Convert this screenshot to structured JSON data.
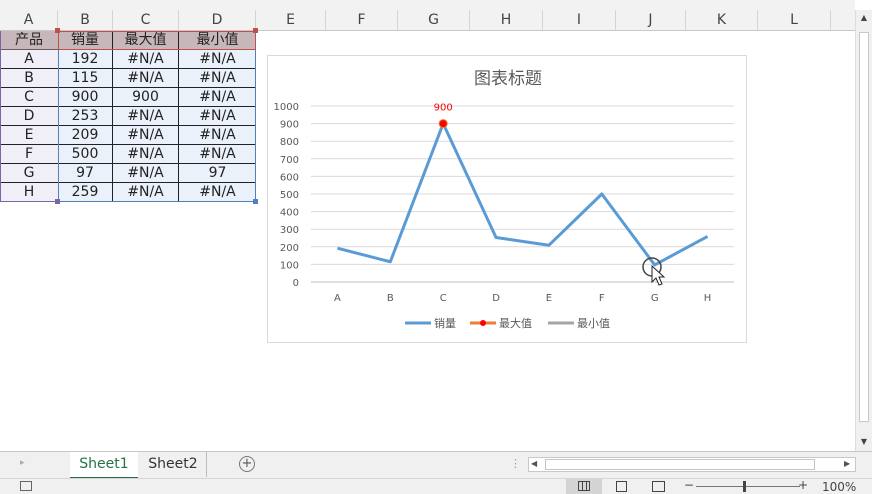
{
  "columns": [
    "A",
    "B",
    "C",
    "D",
    "E",
    "F",
    "G",
    "H",
    "I",
    "J",
    "K",
    "L"
  ],
  "table": {
    "headers": [
      "产品",
      "销量",
      "最大值",
      "最小值"
    ],
    "rows": [
      [
        "A",
        "192",
        "#N/A",
        "#N/A"
      ],
      [
        "B",
        "115",
        "#N/A",
        "#N/A"
      ],
      [
        "C",
        "900",
        "900",
        "#N/A"
      ],
      [
        "D",
        "253",
        "#N/A",
        "#N/A"
      ],
      [
        "E",
        "209",
        "#N/A",
        "#N/A"
      ],
      [
        "F",
        "500",
        "#N/A",
        "#N/A"
      ],
      [
        "G",
        "97",
        "#N/A",
        "97"
      ],
      [
        "H",
        "259",
        "#N/A",
        "#N/A"
      ]
    ]
  },
  "chart_data": {
    "type": "line",
    "title": "图表标题",
    "categories": [
      "A",
      "B",
      "C",
      "D",
      "E",
      "F",
      "G",
      "H"
    ],
    "ylim": [
      0,
      1000
    ],
    "yticks": [
      "0",
      "100",
      "200",
      "300",
      "400",
      "500",
      "600",
      "700",
      "800",
      "900",
      "1000"
    ],
    "series": [
      {
        "name": "销量",
        "values": [
          192,
          115,
          900,
          253,
          209,
          500,
          97,
          259
        ],
        "color": "#5b9bd5"
      },
      {
        "name": "最大值",
        "values": [
          null,
          null,
          900,
          null,
          null,
          null,
          null,
          null
        ],
        "color": "#ed7d31",
        "marker_color": "#ff0000"
      },
      {
        "name": "最小值",
        "values": [
          null,
          null,
          null,
          null,
          null,
          null,
          97,
          null
        ],
        "color": "#a5a5a5"
      }
    ],
    "data_labels": [
      {
        "series": "最大值",
        "category": "C",
        "text": "900",
        "color": "#ff0000"
      }
    ],
    "grid": true,
    "legend": "bottom"
  },
  "sheets": [
    "Sheet1",
    "Sheet2"
  ],
  "active_sheet": "Sheet1",
  "zoom": "100%",
  "colors": {
    "accent": "#217346"
  }
}
